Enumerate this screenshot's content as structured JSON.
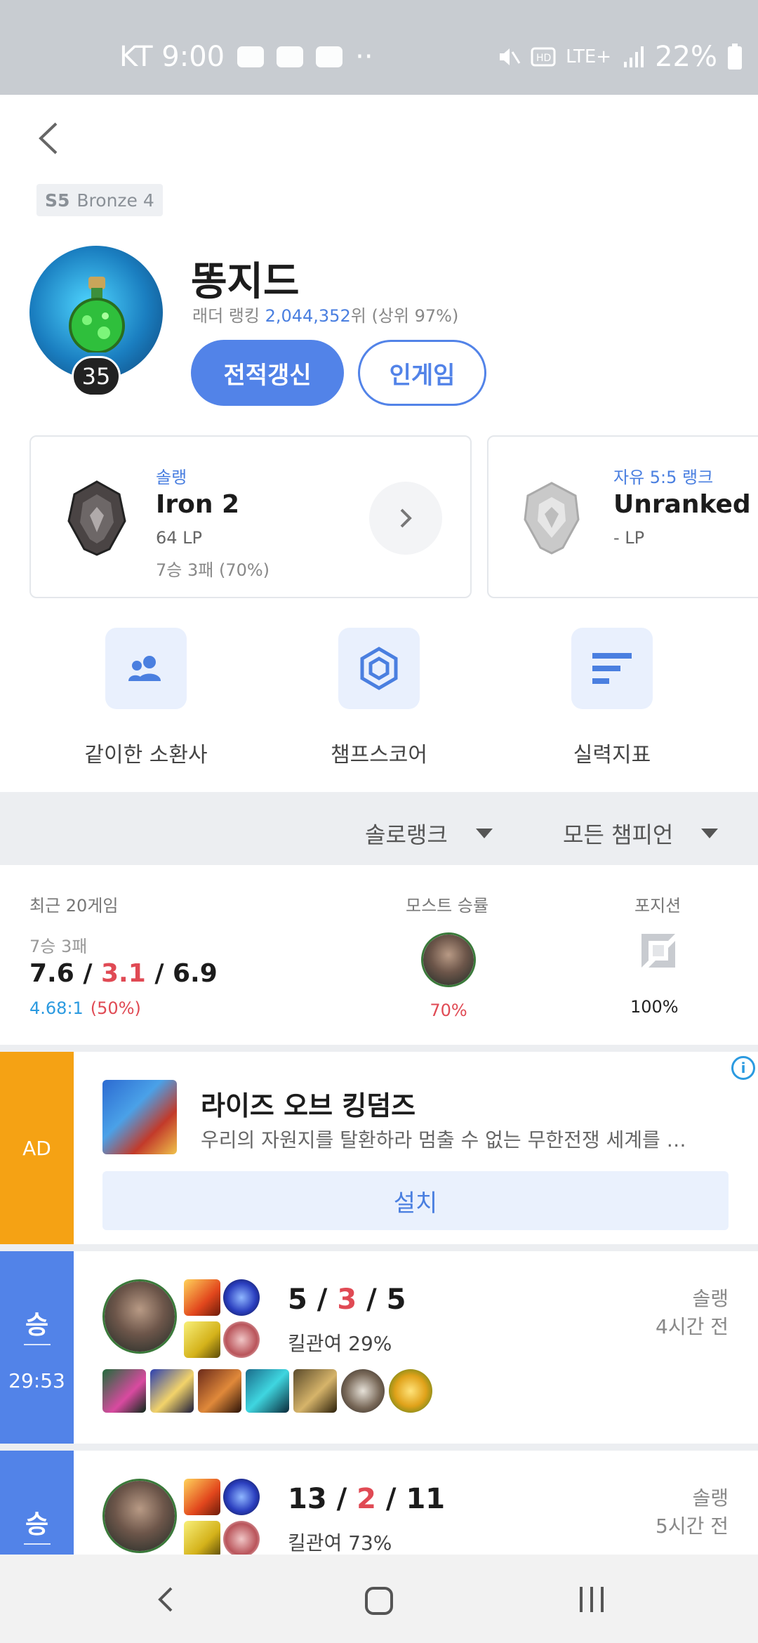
{
  "status_bar": {
    "carrier_time": "KT 9:00",
    "dots": "··",
    "network": "LTE+",
    "battery": "22%"
  },
  "profile": {
    "season_code": "S5",
    "season_tier": "Bronze 4",
    "level": "35",
    "name": "똥지드",
    "ladder_prefix": "래더 랭킹 ",
    "ladder_rank": "2,044,352",
    "ladder_suffix": "위  (상위 97%)",
    "refresh_button": "전적갱신",
    "ingame_button": "인게임"
  },
  "rank_cards": [
    {
      "queue": "솔랭",
      "tier": "Iron 2",
      "lp": "64 LP",
      "record": "7승 3패 (70%)"
    },
    {
      "queue": "자유 5:5 랭크",
      "tier": "Unranked",
      "lp": "- LP"
    }
  ],
  "quick_menu": [
    {
      "label": "같이한 소환사",
      "icon": "people-icon"
    },
    {
      "label": "챔프스코어",
      "icon": "hexagon-icon"
    },
    {
      "label": "실력지표",
      "icon": "bars-icon"
    }
  ],
  "filters": {
    "queue": "솔로랭크",
    "champion": "모든 챔피언"
  },
  "summary": {
    "recent_label": "최근 20게임",
    "record": "7승 3패",
    "kills": "7.6",
    "deaths": "3.1",
    "assists": "6.9",
    "kda_ratio": "4.68:1",
    "winrate": "(50%)",
    "most_label": "모스트 승률",
    "most_winrate": "70%",
    "position_label": "포지션",
    "position_pct": "100%"
  },
  "ad": {
    "tag": "AD",
    "title": "라이즈 오브 킹덤즈",
    "description": "우리의 자원지를 탈환하라 멈출 수 없는 무한전쟁 세계를 …",
    "install_button": "설치",
    "info": "i"
  },
  "matches": [
    {
      "result": "승",
      "duration": "29:53",
      "kills": "5",
      "deaths": "3",
      "assists": "5",
      "kill_participation": "킬관여 29%",
      "queue": "솔랭",
      "time_ago": "4시간 전"
    },
    {
      "result": "승",
      "kills": "13",
      "deaths": "2",
      "assists": "11",
      "kill_participation": "킬관여 73%",
      "queue": "솔랭",
      "time_ago": "5시간 전"
    }
  ],
  "colors": {
    "accent": "#5283e8",
    "loss_red": "#e04a54",
    "ad_orange": "#f5a214",
    "ratio_blue": "#2b9ae0"
  }
}
